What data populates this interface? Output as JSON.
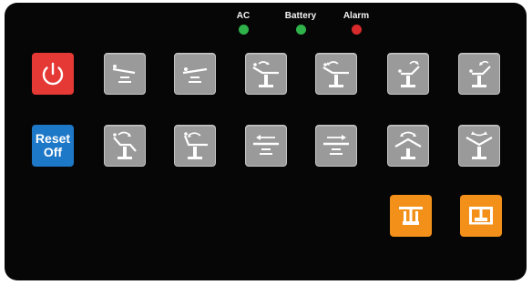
{
  "indicators": [
    {
      "label": "AC",
      "color": "#2fb24a",
      "icon": "led-dot"
    },
    {
      "label": "Battery",
      "color": "#2fb24a",
      "icon": "led-dot"
    },
    {
      "label": "Alarm",
      "color": "#d92b2b",
      "icon": "led-dot"
    }
  ],
  "colors": {
    "power": "#e53935",
    "reset": "#1e78c8",
    "orange": "#f39019",
    "key_gray": "#9a9a9a",
    "glyph": "#ffffff",
    "panel": "#060606"
  },
  "buttons": {
    "power": {
      "icon": "power-icon"
    },
    "reset": {
      "label": "Reset\nOff"
    },
    "row1": [
      "trendelenburg-icon",
      "reverse-trendelenburg-icon",
      "back-section-up-icon",
      "back-section-down-icon",
      "leg-section-up-icon",
      "leg-section-down-icon"
    ],
    "row2": [
      "chair-position-icon",
      "flat-position-icon",
      "slide-to-head-icon",
      "slide-to-foot-icon",
      "flex-icon",
      "reflex-icon"
    ],
    "row3": [
      "lock-floor-icon",
      "unlock-floor-icon"
    ]
  }
}
